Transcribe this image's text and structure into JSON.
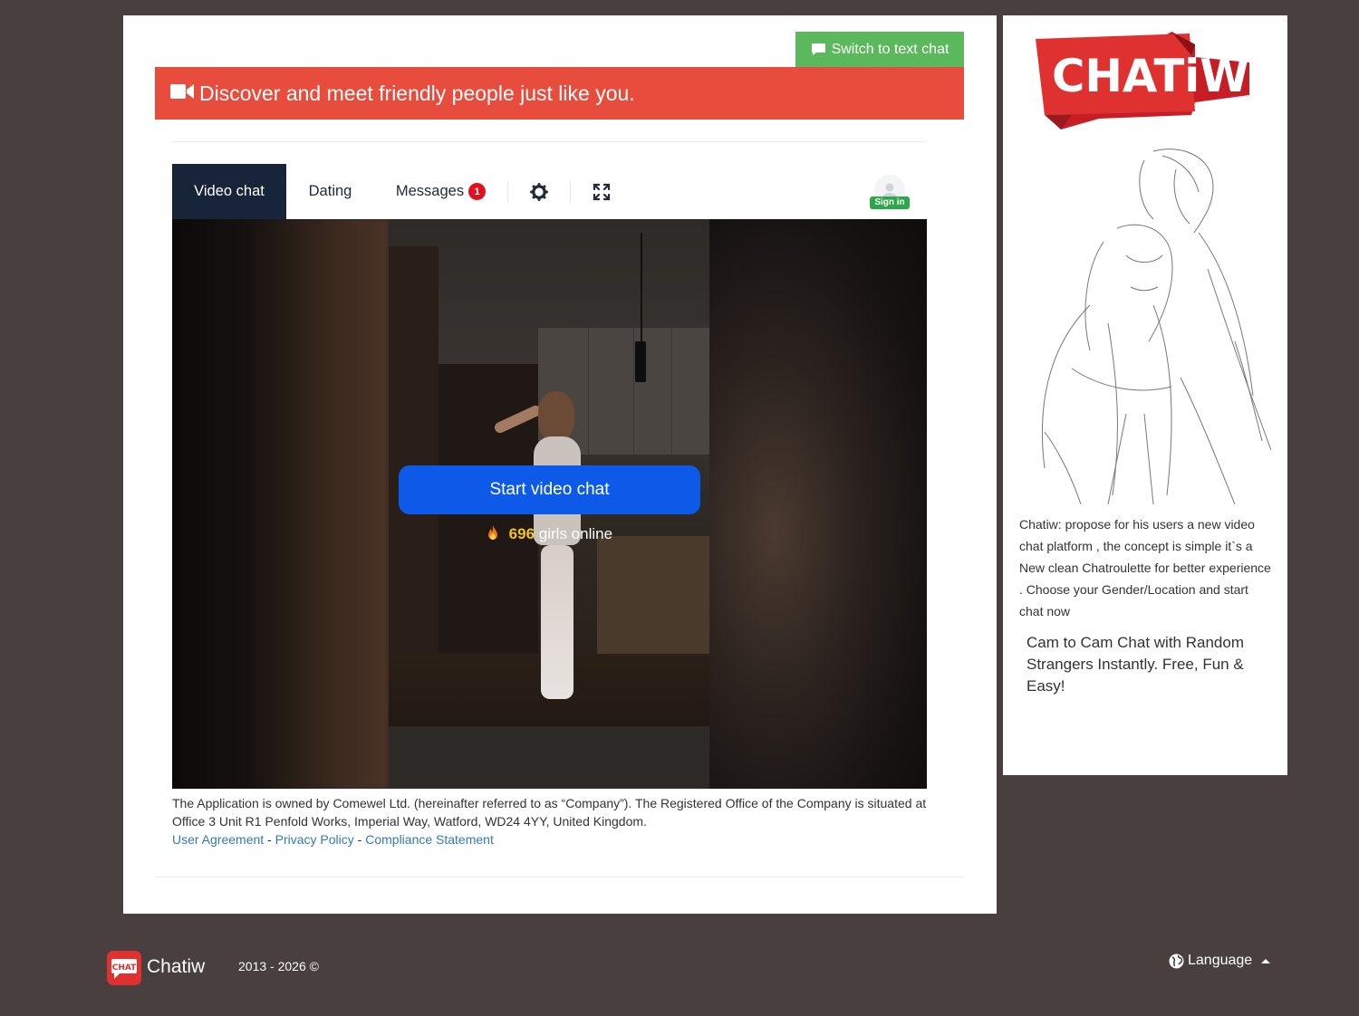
{
  "header": {
    "switch_button_label": "Switch to text chat",
    "banner_text": "Discover and meet friendly people just like you."
  },
  "tabs": {
    "video_chat": "Video chat",
    "dating": "Dating",
    "messages": "Messages",
    "messages_badge": "1",
    "signin_label": "Sign in"
  },
  "video": {
    "start_button_label": "Start video chat",
    "online_count": "696",
    "online_suffix": "girls online"
  },
  "legal": {
    "text": "The Application is owned by Comewel Ltd. (hereinafter referred to as “Company”). The Registered Office of the Company is situated at Office 3 Unit R1 Penfold Works, Imperial Way, Watford, WD24 4YY, United Kingdom.",
    "links": [
      "User Agreement",
      "Privacy Policy",
      "Compliance Statement"
    ],
    "separator": " - "
  },
  "sidebar": {
    "logo_text": "CHATiW",
    "description": "Chatiw: propose for his users a new video chat platform , the concept is simple it`s a New clean Chatroulette for better experience . Choose your Gender/Location and start chat now",
    "tagline": "Cam to Cam Chat with Random Strangers Instantly. Free, Fun & Easy!"
  },
  "footer": {
    "logo_text": "CHAT",
    "brand": "Chatiw",
    "copyright": "2013 - 2026 ©",
    "language_label": "Language"
  },
  "colors": {
    "background": "#483f3e",
    "banner": "#e84c3d",
    "switch_button": "#5cb85c",
    "active_tab": "#17243a",
    "start_button": "#0d5ae8",
    "badge": "#e01020",
    "link": "#337ab7",
    "online_count": "#f5c518"
  },
  "icons": {
    "switch_button": "speech-bubble-icon",
    "banner": "video-camera-icon",
    "settings": "gear-icon",
    "fullscreen": "expand-icon",
    "signin": "user-avatar-icon",
    "online": "fire-icon",
    "language": "globe-icon"
  }
}
